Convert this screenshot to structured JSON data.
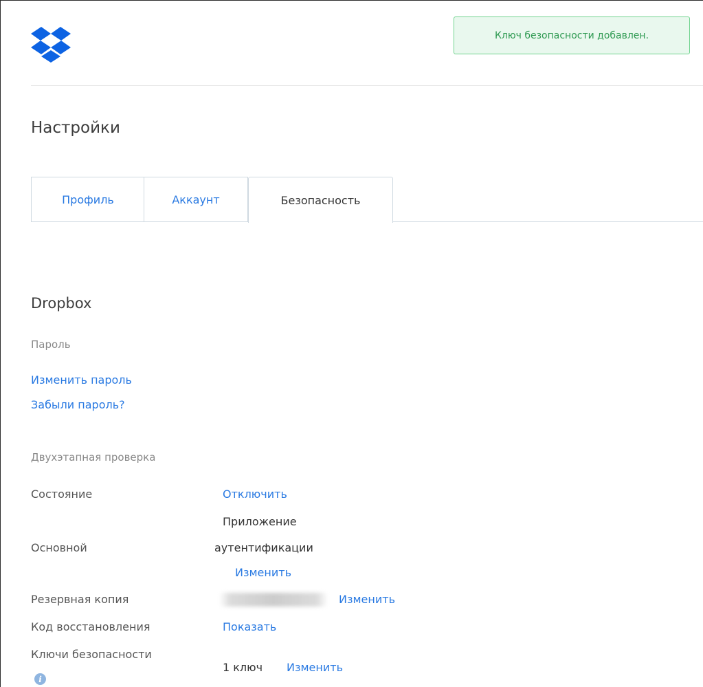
{
  "toast": {
    "message": "Ключ безопасности добавлен."
  },
  "page": {
    "title": "Настройки"
  },
  "tabs": [
    {
      "label": "Профиль",
      "active": false
    },
    {
      "label": "Аккаунт",
      "active": false
    },
    {
      "label": "Безопасность",
      "active": true
    }
  ],
  "section": {
    "title": "Dropbox",
    "password": {
      "heading": "Пароль",
      "change_link": "Изменить пароль",
      "forgot_link": "Забыли пароль?"
    },
    "two_step": {
      "heading": "Двухэтапная проверка",
      "status_label": "Состояние",
      "status_action": "Отключить",
      "primary_label": "Основной",
      "primary_value_line1": "Приложение",
      "primary_value_line2": "аутентификации",
      "primary_action": "Изменить",
      "backup_label": "Резервная копия",
      "backup_action": "Изменить",
      "recovery_label": "Код восстановления",
      "recovery_action": "Показать",
      "keys_label": "Ключи безопасности",
      "keys_value": "1 ключ",
      "keys_action": "Изменить"
    }
  },
  "colors": {
    "link": "#2a7ae2",
    "brand": "#0d63e3",
    "toast_bg": "#e9f8ee",
    "toast_border": "#6fd38e",
    "toast_text": "#2f9a52"
  },
  "icons": {
    "logo": "dropbox-logo",
    "info": "info-icon"
  }
}
